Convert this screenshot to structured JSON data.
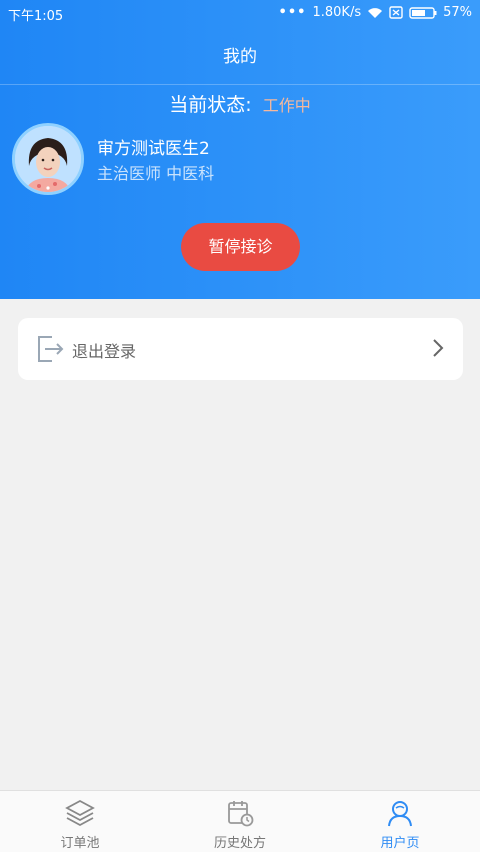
{
  "status_bar": {
    "time": "下午1:05",
    "dots": "•••",
    "speed": "1.80K/s",
    "battery": "57%"
  },
  "header": {
    "title": "我的",
    "status_label": "当前状态:",
    "status_value": "工作中",
    "doctor_name": "审方测试医生2",
    "doctor_title": "主治医师  中医科",
    "pause_button": "暂停接诊"
  },
  "menu": {
    "logout_label": "退出登录"
  },
  "tabs": [
    {
      "label": "订单池",
      "icon": "layers-icon"
    },
    {
      "label": "历史处方",
      "icon": "calendar-clock-icon"
    },
    {
      "label": "用户页",
      "icon": "user-icon",
      "active": true
    }
  ],
  "colors": {
    "accent": "#2f8cf4",
    "header_start": "#1f86f5",
    "header_end": "#3a9cfb",
    "button": "#e94b42",
    "status": "#f5b89c"
  }
}
